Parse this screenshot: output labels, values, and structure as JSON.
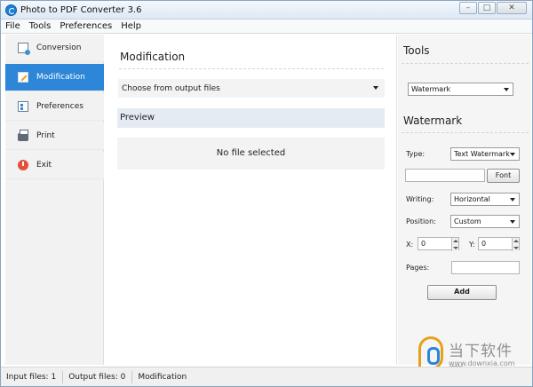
{
  "window": {
    "title": "Photo to PDF Converter 3.6"
  },
  "menu": [
    "File",
    "Tools",
    "Preferences",
    "Help"
  ],
  "sidebar": {
    "items": [
      {
        "label": "Conversion",
        "icon": "conversion-icon",
        "active": false
      },
      {
        "label": "Modification",
        "icon": "modification-icon",
        "active": true
      },
      {
        "label": "Preferences",
        "icon": "preferences-icon",
        "active": false
      },
      {
        "label": "Print",
        "icon": "printer-icon",
        "active": false
      },
      {
        "label": "Exit",
        "icon": "power-icon",
        "active": false
      }
    ]
  },
  "main": {
    "title": "Modification",
    "output_select": "Choose from output files",
    "preview_label": "Preview",
    "empty_text": "No file selected"
  },
  "tools": {
    "title": "Tools",
    "tool_select": "Watermark",
    "watermark": {
      "title": "Watermark",
      "type_label": "Type:",
      "type_value": "Text Watermark",
      "text_value": "",
      "font_button": "Font",
      "writing_label": "Writing:",
      "writing_value": "Horizontal",
      "position_label": "Position:",
      "position_value": "Custom",
      "x_label": "X:",
      "x_value": "0",
      "y_label": "Y:",
      "y_value": "0",
      "pages_label": "Pages:",
      "pages_value": "",
      "add_button": "Add"
    }
  },
  "status": {
    "input_files": "Input files: 1",
    "output_files": "Output files: 0",
    "mode": "Modification"
  },
  "brand": {
    "name": "当下软件园",
    "url": "www.downxia.com"
  },
  "colors": {
    "accent": "#2d86d8",
    "sidebar_bg": "#f2f2f2",
    "preview_bg": "#e5ebf2"
  }
}
